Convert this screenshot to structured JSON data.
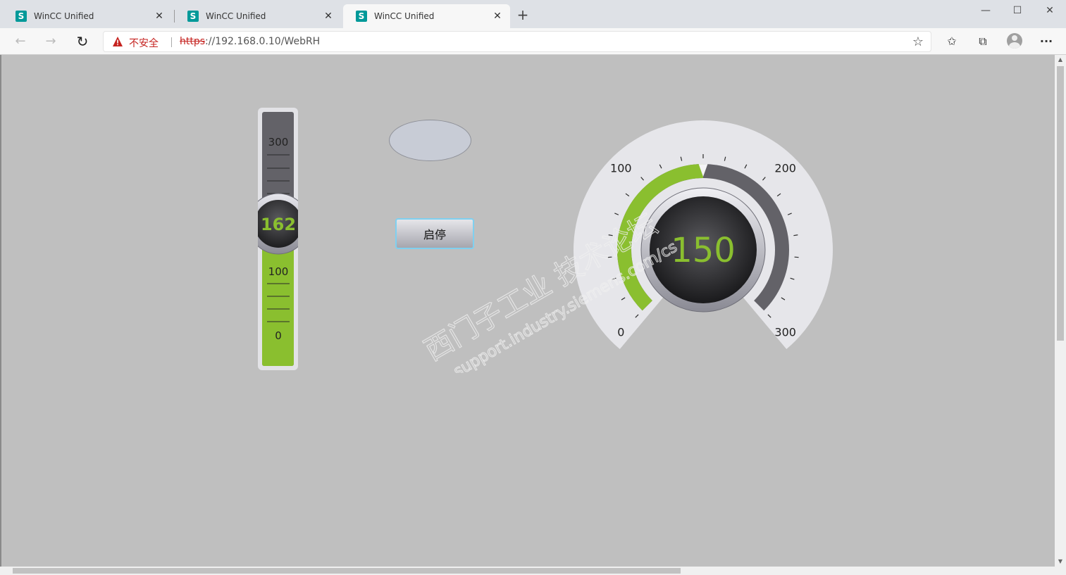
{
  "browser": {
    "tabs": [
      {
        "title": "WinCC Unified",
        "favicon": "S",
        "active": false
      },
      {
        "title": "WinCC Unified",
        "favicon": "S",
        "active": false
      },
      {
        "title": "WinCC Unified",
        "favicon": "S",
        "active": true
      }
    ],
    "new_tab": "+",
    "window_controls": {
      "minimize": "—",
      "maximize": "☐",
      "close": "✕"
    },
    "nav": {
      "back": "←",
      "forward": "→",
      "refresh": "↻"
    },
    "address": {
      "security_label": "不安全",
      "url_scheme": "https",
      "url_rest": "://192.168.0.10/WebRH"
    },
    "toolbar_icons": [
      "star-icon",
      "favorites-icon",
      "collections-icon",
      "profile-icon",
      "more-icon"
    ],
    "more_label": "···"
  },
  "hmi": {
    "slider": {
      "value": 162,
      "min": 0,
      "max": 300,
      "tick_labels": [
        "300",
        "100",
        "0"
      ],
      "fill_color": "#8abf2f",
      "track_color": "#636268"
    },
    "lamp": {
      "state": "off",
      "color": "#c8ccd6"
    },
    "start_stop_button": {
      "label": "启停"
    },
    "gauge": {
      "value": 150,
      "min": 0,
      "max": 300,
      "tick_labels": [
        "0",
        "100",
        "200",
        "300"
      ],
      "fill_color": "#8abf2f",
      "track_color": "#636268",
      "value_color": "#8abf2f"
    }
  },
  "watermark": {
    "line1": "西门子工业 技术论坛",
    "line2": "support.industry.siemens.com/cs"
  }
}
